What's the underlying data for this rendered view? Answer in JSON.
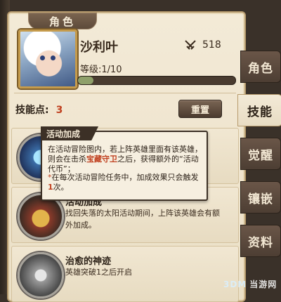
{
  "panel": {
    "title": "角色"
  },
  "hero": {
    "name": "沙利叶",
    "power": "518",
    "level_text": "等级:1/10",
    "level_progress": 0.1
  },
  "skills": {
    "points_label": "技能点:",
    "points_value": "3",
    "reset_label": "重置",
    "items": [
      {
        "name": "",
        "desc": ""
      },
      {
        "name": "活动加成",
        "desc": "找回失落的太阳活动期间，上阵该英雄会有额外加成。"
      },
      {
        "name": "治愈的神迹",
        "desc": "英雄突破1之后开启"
      }
    ]
  },
  "tooltip": {
    "title": "活动加成",
    "line1": "在活动冒险图内，若上阵英雄里面有该英雄，则会在击杀",
    "highlight": "宝藏守卫",
    "line2": "之后，获得额外的“活动代币”；",
    "note_star": "*",
    "note_a": "在每次活动冒险任务中，加成效果只会触发",
    "note_num": "1",
    "note_b": "次。"
  },
  "tabs": [
    "角色",
    "技能",
    "觉醒",
    "镶嵌",
    "资料"
  ],
  "active_tab": "技能",
  "watermark": {
    "logo": "3DM",
    "text": "当游网"
  },
  "colors": {
    "accent_red": "#c0401f",
    "panel_bg": "#f3ead7",
    "tab_dark": "#5a483b"
  }
}
